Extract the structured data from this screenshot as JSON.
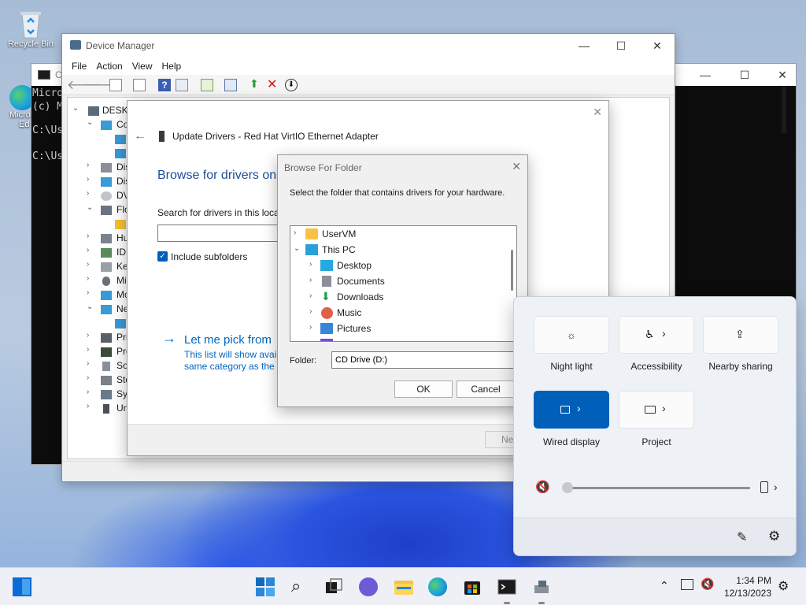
{
  "desktop": {
    "recycle_bin": "Recycle Bin",
    "edge_label_1": "Micro",
    "edge_label_2": "Ed"
  },
  "cmd": {
    "title": "C",
    "lines": [
      "Micro",
      "(c) M",
      "",
      "C:\\Us",
      "",
      "C:\\Us"
    ]
  },
  "device_manager": {
    "title": "Device Manager",
    "menu": [
      "File",
      "Action",
      "View",
      "Help"
    ],
    "tree": [
      {
        "label": "DESKT",
        "arrow": "⌄"
      },
      {
        "label": "Co",
        "arrow": "⌄"
      },
      {
        "label": "",
        "arrow": ""
      },
      {
        "label": "",
        "arrow": ""
      },
      {
        "label": "Dis",
        "arrow": "›"
      },
      {
        "label": "Dis",
        "arrow": "›"
      },
      {
        "label": "DV",
        "arrow": "›"
      },
      {
        "label": "Flo",
        "arrow": "⌄"
      },
      {
        "label": "",
        "arrow": ""
      },
      {
        "label": "Hu",
        "arrow": "›"
      },
      {
        "label": "IDE",
        "arrow": "›"
      },
      {
        "label": "Key",
        "arrow": "›"
      },
      {
        "label": "Mi",
        "arrow": "›"
      },
      {
        "label": "Mo",
        "arrow": "›"
      },
      {
        "label": "Ne",
        "arrow": "⌄"
      },
      {
        "label": "",
        "arrow": ""
      },
      {
        "label": "Pri",
        "arrow": "›"
      },
      {
        "label": "Pro",
        "arrow": "›"
      },
      {
        "label": "Sof",
        "arrow": "›"
      },
      {
        "label": "Sto",
        "arrow": "›"
      },
      {
        "label": "Sys",
        "arrow": "›"
      },
      {
        "label": "Uni",
        "arrow": "›"
      }
    ]
  },
  "wizard": {
    "title": "Update Drivers - Red Hat VirtIO Ethernet Adapter",
    "heading": "Browse for drivers on",
    "search_label": "Search for drivers in this locat",
    "search_value": "",
    "include_subfolders": "Include subfolders",
    "pick_link": "Let me pick from",
    "pick_desc_1": "This list will show avail",
    "pick_desc_2": "same category as the d",
    "next_button": "Nex"
  },
  "browse_folder": {
    "title": "Browse For Folder",
    "instruction": "Select the folder that contains drivers for your hardware.",
    "tree": [
      {
        "label": "UserVM",
        "arrow": "›",
        "icon": "folder-icon",
        "color": "#f5c242"
      },
      {
        "label": "This PC",
        "arrow": "⌄",
        "icon": "computer-icon",
        "color": "#2aa1d6"
      },
      {
        "label": "Desktop",
        "arrow": "›",
        "icon": "desktop-icon",
        "color": "#28a8e0"
      },
      {
        "label": "Documents",
        "arrow": "›",
        "icon": "documents-icon",
        "color": "#8a8f98"
      },
      {
        "label": "Downloads",
        "arrow": "›",
        "icon": "downloads-icon",
        "color": "#1a9e4a"
      },
      {
        "label": "Music",
        "arrow": "›",
        "icon": "music-icon",
        "color": "#e0604a"
      },
      {
        "label": "Pictures",
        "arrow": "›",
        "icon": "pictures-icon",
        "color": "#3a86d6"
      }
    ],
    "folder_label": "Folder:",
    "folder_value": "CD Drive (D:)",
    "ok": "OK",
    "cancel": "Cancel"
  },
  "quick_settings": {
    "tiles": [
      {
        "label": "Night light",
        "icon": "brightness-icon",
        "on": false,
        "chevron": ""
      },
      {
        "label": "Accessibility",
        "icon": "accessibility-icon",
        "on": false,
        "chevron": "›"
      },
      {
        "label": "Nearby sharing",
        "icon": "share-icon",
        "on": false,
        "chevron": ""
      },
      {
        "label": "Wired display",
        "icon": "cast-icon",
        "on": true,
        "chevron": "›"
      },
      {
        "label": "Project",
        "icon": "project-icon",
        "on": false,
        "chevron": "›"
      }
    ],
    "volume_level": 0
  },
  "taskbar": {
    "time": "1:34 PM",
    "date": "12/13/2023"
  },
  "colors": {
    "accent": "#005fb8",
    "link": "#0067c0",
    "heading": "#1f4e9a"
  }
}
